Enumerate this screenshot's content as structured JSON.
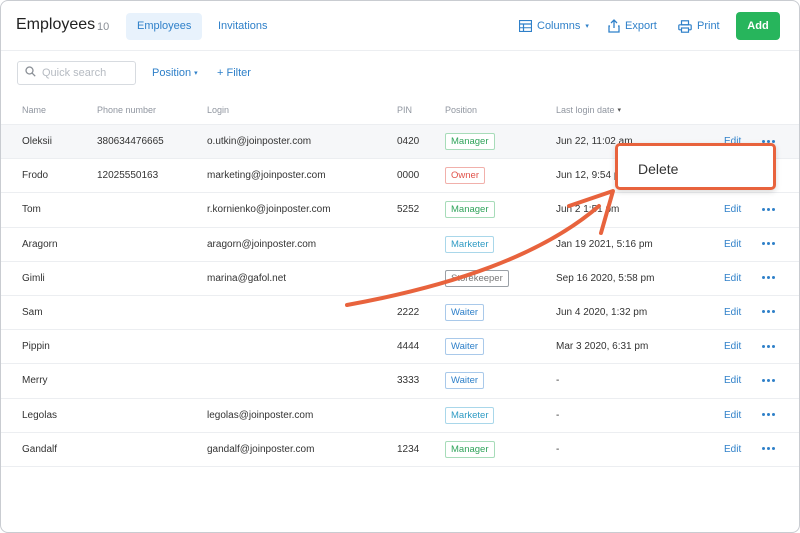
{
  "header": {
    "title": "Employees",
    "count": "10",
    "tabs": [
      {
        "label": "Employees",
        "active": true
      },
      {
        "label": "Invitations",
        "active": false
      }
    ],
    "columns_label": "Columns",
    "export_label": "Export",
    "print_label": "Print",
    "add_label": "Add"
  },
  "filters": {
    "search_placeholder": "Quick search",
    "position_label": "Position",
    "add_filter_label": "+ Filter"
  },
  "table": {
    "columns": [
      "Name",
      "Phone number",
      "Login",
      "PIN",
      "Position",
      "Last login date"
    ],
    "edit_label": "Edit",
    "rows": [
      {
        "name": "Oleksii",
        "phone": "380634476665",
        "login": "o.utkin@joinposter.com",
        "pin": "0420",
        "position": "Manager",
        "last_login": "Jun 22, 11:02 am"
      },
      {
        "name": "Frodo",
        "phone": "12025550163",
        "login": "marketing@joinposter.com",
        "pin": "0000",
        "position": "Owner",
        "last_login": "Jun 12, 9:54 p"
      },
      {
        "name": "Tom",
        "phone": "",
        "login": "r.kornienko@joinposter.com",
        "pin": "5252",
        "position": "Manager",
        "last_login": "Jun 2 1:51 pm"
      },
      {
        "name": "Aragorn",
        "phone": "",
        "login": "aragorn@joinposter.com",
        "pin": "",
        "position": "Marketer",
        "last_login": "Jan 19 2021, 5:16 pm"
      },
      {
        "name": "Gimli",
        "phone": "",
        "login": "marina@gafol.net",
        "pin": "",
        "position": "Storekeeper",
        "last_login": "Sep 16 2020, 5:58 pm"
      },
      {
        "name": "Sam",
        "phone": "",
        "login": "",
        "pin": "2222",
        "position": "Waiter",
        "last_login": "Jun 4 2020, 1:32 pm"
      },
      {
        "name": "Pippin",
        "phone": "",
        "login": "",
        "pin": "4444",
        "position": "Waiter",
        "last_login": "Mar 3 2020, 6:31 pm"
      },
      {
        "name": "Merry",
        "phone": "",
        "login": "",
        "pin": "3333",
        "position": "Waiter",
        "last_login": "-"
      },
      {
        "name": "Legolas",
        "phone": "",
        "login": "legolas@joinposter.com",
        "pin": "",
        "position": "Marketer",
        "last_login": "-"
      },
      {
        "name": "Gandalf",
        "phone": "",
        "login": "gandalf@joinposter.com",
        "pin": "1234",
        "position": "Manager",
        "last_login": "-"
      }
    ]
  },
  "popup": {
    "delete_label": "Delete"
  },
  "colors": {
    "accent": "#2f80c9",
    "add_button": "#27b55c",
    "callout": "#e8633d"
  },
  "icons": [
    "columns-icon",
    "export-icon",
    "print-icon",
    "search-icon",
    "more-icon",
    "sort-caret-icon"
  ]
}
